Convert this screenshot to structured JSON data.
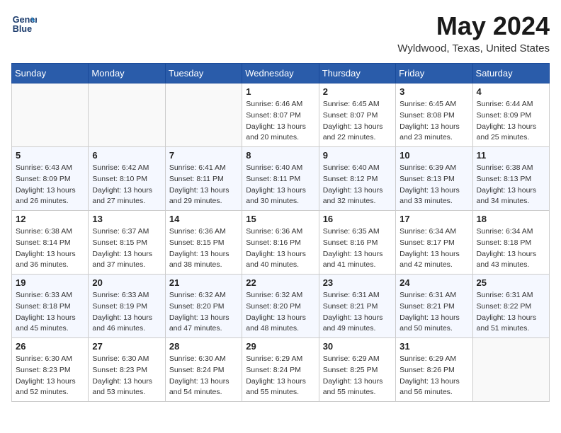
{
  "header": {
    "logo_line1": "General",
    "logo_line2": "Blue",
    "month_title": "May 2024",
    "location": "Wyldwood, Texas, United States"
  },
  "weekdays": [
    "Sunday",
    "Monday",
    "Tuesday",
    "Wednesday",
    "Thursday",
    "Friday",
    "Saturday"
  ],
  "weeks": [
    [
      {
        "day": "",
        "info": ""
      },
      {
        "day": "",
        "info": ""
      },
      {
        "day": "",
        "info": ""
      },
      {
        "day": "1",
        "info": "Sunrise: 6:46 AM\nSunset: 8:07 PM\nDaylight: 13 hours\nand 20 minutes."
      },
      {
        "day": "2",
        "info": "Sunrise: 6:45 AM\nSunset: 8:07 PM\nDaylight: 13 hours\nand 22 minutes."
      },
      {
        "day": "3",
        "info": "Sunrise: 6:45 AM\nSunset: 8:08 PM\nDaylight: 13 hours\nand 23 minutes."
      },
      {
        "day": "4",
        "info": "Sunrise: 6:44 AM\nSunset: 8:09 PM\nDaylight: 13 hours\nand 25 minutes."
      }
    ],
    [
      {
        "day": "5",
        "info": "Sunrise: 6:43 AM\nSunset: 8:09 PM\nDaylight: 13 hours\nand 26 minutes."
      },
      {
        "day": "6",
        "info": "Sunrise: 6:42 AM\nSunset: 8:10 PM\nDaylight: 13 hours\nand 27 minutes."
      },
      {
        "day": "7",
        "info": "Sunrise: 6:41 AM\nSunset: 8:11 PM\nDaylight: 13 hours\nand 29 minutes."
      },
      {
        "day": "8",
        "info": "Sunrise: 6:40 AM\nSunset: 8:11 PM\nDaylight: 13 hours\nand 30 minutes."
      },
      {
        "day": "9",
        "info": "Sunrise: 6:40 AM\nSunset: 8:12 PM\nDaylight: 13 hours\nand 32 minutes."
      },
      {
        "day": "10",
        "info": "Sunrise: 6:39 AM\nSunset: 8:13 PM\nDaylight: 13 hours\nand 33 minutes."
      },
      {
        "day": "11",
        "info": "Sunrise: 6:38 AM\nSunset: 8:13 PM\nDaylight: 13 hours\nand 34 minutes."
      }
    ],
    [
      {
        "day": "12",
        "info": "Sunrise: 6:38 AM\nSunset: 8:14 PM\nDaylight: 13 hours\nand 36 minutes."
      },
      {
        "day": "13",
        "info": "Sunrise: 6:37 AM\nSunset: 8:15 PM\nDaylight: 13 hours\nand 37 minutes."
      },
      {
        "day": "14",
        "info": "Sunrise: 6:36 AM\nSunset: 8:15 PM\nDaylight: 13 hours\nand 38 minutes."
      },
      {
        "day": "15",
        "info": "Sunrise: 6:36 AM\nSunset: 8:16 PM\nDaylight: 13 hours\nand 40 minutes."
      },
      {
        "day": "16",
        "info": "Sunrise: 6:35 AM\nSunset: 8:16 PM\nDaylight: 13 hours\nand 41 minutes."
      },
      {
        "day": "17",
        "info": "Sunrise: 6:34 AM\nSunset: 8:17 PM\nDaylight: 13 hours\nand 42 minutes."
      },
      {
        "day": "18",
        "info": "Sunrise: 6:34 AM\nSunset: 8:18 PM\nDaylight: 13 hours\nand 43 minutes."
      }
    ],
    [
      {
        "day": "19",
        "info": "Sunrise: 6:33 AM\nSunset: 8:18 PM\nDaylight: 13 hours\nand 45 minutes."
      },
      {
        "day": "20",
        "info": "Sunrise: 6:33 AM\nSunset: 8:19 PM\nDaylight: 13 hours\nand 46 minutes."
      },
      {
        "day": "21",
        "info": "Sunrise: 6:32 AM\nSunset: 8:20 PM\nDaylight: 13 hours\nand 47 minutes."
      },
      {
        "day": "22",
        "info": "Sunrise: 6:32 AM\nSunset: 8:20 PM\nDaylight: 13 hours\nand 48 minutes."
      },
      {
        "day": "23",
        "info": "Sunrise: 6:31 AM\nSunset: 8:21 PM\nDaylight: 13 hours\nand 49 minutes."
      },
      {
        "day": "24",
        "info": "Sunrise: 6:31 AM\nSunset: 8:21 PM\nDaylight: 13 hours\nand 50 minutes."
      },
      {
        "day": "25",
        "info": "Sunrise: 6:31 AM\nSunset: 8:22 PM\nDaylight: 13 hours\nand 51 minutes."
      }
    ],
    [
      {
        "day": "26",
        "info": "Sunrise: 6:30 AM\nSunset: 8:23 PM\nDaylight: 13 hours\nand 52 minutes."
      },
      {
        "day": "27",
        "info": "Sunrise: 6:30 AM\nSunset: 8:23 PM\nDaylight: 13 hours\nand 53 minutes."
      },
      {
        "day": "28",
        "info": "Sunrise: 6:30 AM\nSunset: 8:24 PM\nDaylight: 13 hours\nand 54 minutes."
      },
      {
        "day": "29",
        "info": "Sunrise: 6:29 AM\nSunset: 8:24 PM\nDaylight: 13 hours\nand 55 minutes."
      },
      {
        "day": "30",
        "info": "Sunrise: 6:29 AM\nSunset: 8:25 PM\nDaylight: 13 hours\nand 55 minutes."
      },
      {
        "day": "31",
        "info": "Sunrise: 6:29 AM\nSunset: 8:26 PM\nDaylight: 13 hours\nand 56 minutes."
      },
      {
        "day": "",
        "info": ""
      }
    ]
  ]
}
